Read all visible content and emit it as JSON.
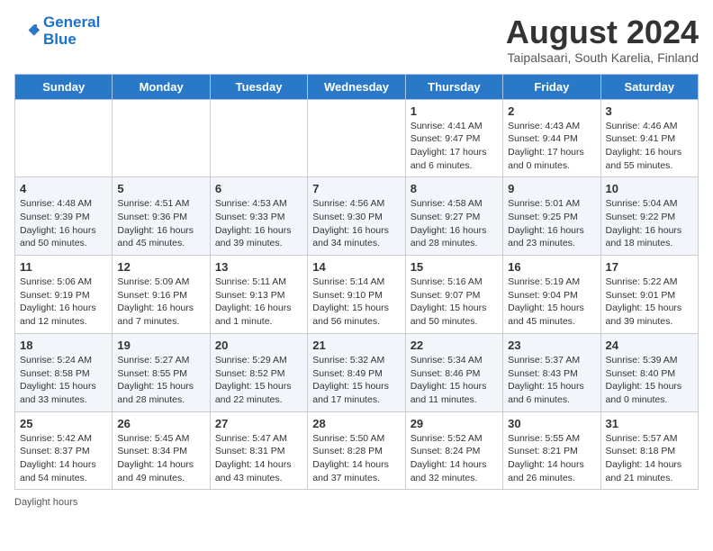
{
  "header": {
    "logo_line1": "General",
    "logo_line2": "Blue",
    "month_title": "August 2024",
    "subtitle": "Taipalsaari, South Karelia, Finland"
  },
  "days_of_week": [
    "Sunday",
    "Monday",
    "Tuesday",
    "Wednesday",
    "Thursday",
    "Friday",
    "Saturday"
  ],
  "weeks": [
    [
      {
        "day": "",
        "info": ""
      },
      {
        "day": "",
        "info": ""
      },
      {
        "day": "",
        "info": ""
      },
      {
        "day": "",
        "info": ""
      },
      {
        "day": "1",
        "info": "Sunrise: 4:41 AM\nSunset: 9:47 PM\nDaylight: 17 hours\nand 6 minutes."
      },
      {
        "day": "2",
        "info": "Sunrise: 4:43 AM\nSunset: 9:44 PM\nDaylight: 17 hours\nand 0 minutes."
      },
      {
        "day": "3",
        "info": "Sunrise: 4:46 AM\nSunset: 9:41 PM\nDaylight: 16 hours\nand 55 minutes."
      }
    ],
    [
      {
        "day": "4",
        "info": "Sunrise: 4:48 AM\nSunset: 9:39 PM\nDaylight: 16 hours\nand 50 minutes."
      },
      {
        "day": "5",
        "info": "Sunrise: 4:51 AM\nSunset: 9:36 PM\nDaylight: 16 hours\nand 45 minutes."
      },
      {
        "day": "6",
        "info": "Sunrise: 4:53 AM\nSunset: 9:33 PM\nDaylight: 16 hours\nand 39 minutes."
      },
      {
        "day": "7",
        "info": "Sunrise: 4:56 AM\nSunset: 9:30 PM\nDaylight: 16 hours\nand 34 minutes."
      },
      {
        "day": "8",
        "info": "Sunrise: 4:58 AM\nSunset: 9:27 PM\nDaylight: 16 hours\nand 28 minutes."
      },
      {
        "day": "9",
        "info": "Sunrise: 5:01 AM\nSunset: 9:25 PM\nDaylight: 16 hours\nand 23 minutes."
      },
      {
        "day": "10",
        "info": "Sunrise: 5:04 AM\nSunset: 9:22 PM\nDaylight: 16 hours\nand 18 minutes."
      }
    ],
    [
      {
        "day": "11",
        "info": "Sunrise: 5:06 AM\nSunset: 9:19 PM\nDaylight: 16 hours\nand 12 minutes."
      },
      {
        "day": "12",
        "info": "Sunrise: 5:09 AM\nSunset: 9:16 PM\nDaylight: 16 hours\nand 7 minutes."
      },
      {
        "day": "13",
        "info": "Sunrise: 5:11 AM\nSunset: 9:13 PM\nDaylight: 16 hours\nand 1 minute."
      },
      {
        "day": "14",
        "info": "Sunrise: 5:14 AM\nSunset: 9:10 PM\nDaylight: 15 hours\nand 56 minutes."
      },
      {
        "day": "15",
        "info": "Sunrise: 5:16 AM\nSunset: 9:07 PM\nDaylight: 15 hours\nand 50 minutes."
      },
      {
        "day": "16",
        "info": "Sunrise: 5:19 AM\nSunset: 9:04 PM\nDaylight: 15 hours\nand 45 minutes."
      },
      {
        "day": "17",
        "info": "Sunrise: 5:22 AM\nSunset: 9:01 PM\nDaylight: 15 hours\nand 39 minutes."
      }
    ],
    [
      {
        "day": "18",
        "info": "Sunrise: 5:24 AM\nSunset: 8:58 PM\nDaylight: 15 hours\nand 33 minutes."
      },
      {
        "day": "19",
        "info": "Sunrise: 5:27 AM\nSunset: 8:55 PM\nDaylight: 15 hours\nand 28 minutes."
      },
      {
        "day": "20",
        "info": "Sunrise: 5:29 AM\nSunset: 8:52 PM\nDaylight: 15 hours\nand 22 minutes."
      },
      {
        "day": "21",
        "info": "Sunrise: 5:32 AM\nSunset: 8:49 PM\nDaylight: 15 hours\nand 17 minutes."
      },
      {
        "day": "22",
        "info": "Sunrise: 5:34 AM\nSunset: 8:46 PM\nDaylight: 15 hours\nand 11 minutes."
      },
      {
        "day": "23",
        "info": "Sunrise: 5:37 AM\nSunset: 8:43 PM\nDaylight: 15 hours\nand 6 minutes."
      },
      {
        "day": "24",
        "info": "Sunrise: 5:39 AM\nSunset: 8:40 PM\nDaylight: 15 hours\nand 0 minutes."
      }
    ],
    [
      {
        "day": "25",
        "info": "Sunrise: 5:42 AM\nSunset: 8:37 PM\nDaylight: 14 hours\nand 54 minutes."
      },
      {
        "day": "26",
        "info": "Sunrise: 5:45 AM\nSunset: 8:34 PM\nDaylight: 14 hours\nand 49 minutes."
      },
      {
        "day": "27",
        "info": "Sunrise: 5:47 AM\nSunset: 8:31 PM\nDaylight: 14 hours\nand 43 minutes."
      },
      {
        "day": "28",
        "info": "Sunrise: 5:50 AM\nSunset: 8:28 PM\nDaylight: 14 hours\nand 37 minutes."
      },
      {
        "day": "29",
        "info": "Sunrise: 5:52 AM\nSunset: 8:24 PM\nDaylight: 14 hours\nand 32 minutes."
      },
      {
        "day": "30",
        "info": "Sunrise: 5:55 AM\nSunset: 8:21 PM\nDaylight: 14 hours\nand 26 minutes."
      },
      {
        "day": "31",
        "info": "Sunrise: 5:57 AM\nSunset: 8:18 PM\nDaylight: 14 hours\nand 21 minutes."
      }
    ]
  ],
  "footer": {
    "daylight_label": "Daylight hours"
  }
}
